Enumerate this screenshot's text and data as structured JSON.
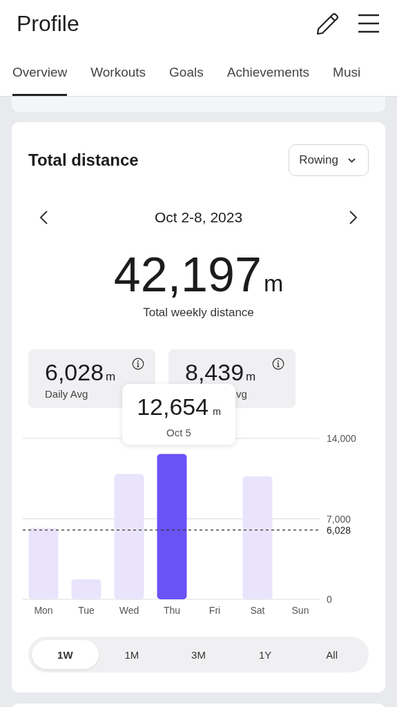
{
  "header": {
    "title": "Profile"
  },
  "tabs": [
    {
      "label": "Overview",
      "selected": true
    },
    {
      "label": "Workouts",
      "selected": false
    },
    {
      "label": "Goals",
      "selected": false
    },
    {
      "label": "Achievements",
      "selected": false
    },
    {
      "label": "Musi",
      "selected": false
    }
  ],
  "card": {
    "title": "Total distance",
    "dropdown": "Rowing",
    "date_range": "Oct 2-8, 2023",
    "total": "42,197",
    "total_unit": "m",
    "total_label": "Total weekly distance",
    "stats": [
      {
        "value": "6,028",
        "unit": "m",
        "label": "Daily Avg"
      },
      {
        "value": "8,439",
        "unit": "m",
        "label": "vg"
      }
    ],
    "tooltip": {
      "value": "12,654",
      "unit": "m",
      "date": "Oct 5"
    },
    "chart_data": {
      "type": "bar",
      "categories": [
        "Mon",
        "Tue",
        "Wed",
        "Thu",
        "Fri",
        "Sat",
        "Sun"
      ],
      "series": [
        {
          "color": "#e9e4fb",
          "values": [
            6200,
            1750,
            10900,
            null,
            0,
            10700,
            0
          ]
        },
        {
          "color": "#6b52f7",
          "values": [
            null,
            null,
            null,
            12650,
            null,
            null,
            null
          ]
        }
      ],
      "ylim": [
        0,
        14000
      ],
      "yticks": [
        0,
        {
          "value": 7000,
          "label": "7,000"
        },
        {
          "value": 14000,
          "label": "14,000"
        }
      ],
      "ref_lines": [
        {
          "axis": "y",
          "value": 6028,
          "label": "6,028"
        }
      ]
    },
    "ranges": [
      {
        "label": "1W",
        "selected": true
      },
      {
        "label": "1M",
        "selected": false
      },
      {
        "label": "3M",
        "selected": false
      },
      {
        "label": "1Y",
        "selected": false
      },
      {
        "label": "All",
        "selected": false
      }
    ]
  }
}
